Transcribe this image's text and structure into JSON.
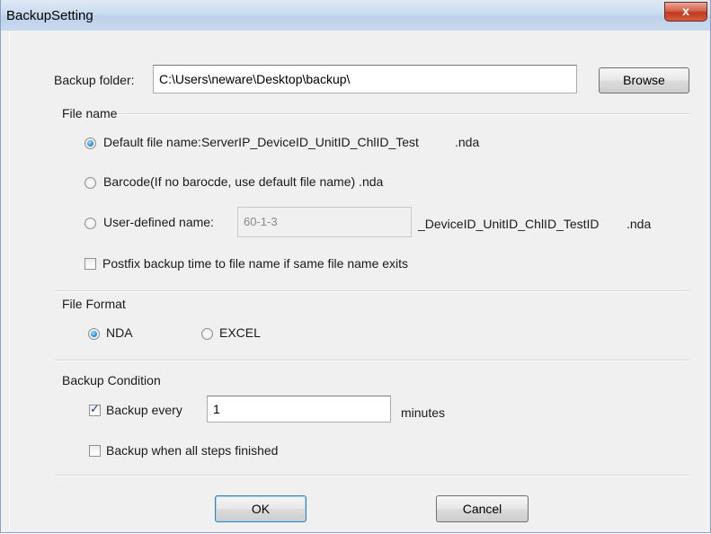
{
  "window": {
    "title": "BackupSetting",
    "close_label": "x"
  },
  "backup_folder": {
    "label": "Backup folder:",
    "value": "C:\\Users\\neware\\Desktop\\backup\\",
    "browse_label": "Browse"
  },
  "file_name": {
    "group_label": "File name",
    "default_option": "Default file name:ServerIP_DeviceID_UnitID_ChlID_Test",
    "default_ext": ".nda",
    "barcode_option": "Barcode(If no barocde, use default file name) .nda",
    "user_defined_option": "User-defined name:",
    "user_defined_value": "60-1-3",
    "user_defined_suffix": "_DeviceID_UnitID_ChlID_TestID",
    "user_defined_ext": ".nda",
    "selected": "default",
    "postfix_label": "Postfix backup time to file name if same file name exits",
    "postfix_checked": false
  },
  "file_format": {
    "group_label": "File Format",
    "nda_label": "NDA",
    "excel_label": "EXCEL",
    "selected": "NDA"
  },
  "backup_condition": {
    "group_label": "Backup Condition",
    "every_label": "Backup every",
    "every_checked": true,
    "every_value": "1",
    "every_unit": "minutes",
    "finished_label": "Backup when all steps finished",
    "finished_checked": false
  },
  "buttons": {
    "ok_label": "OK",
    "cancel_label": "Cancel"
  }
}
